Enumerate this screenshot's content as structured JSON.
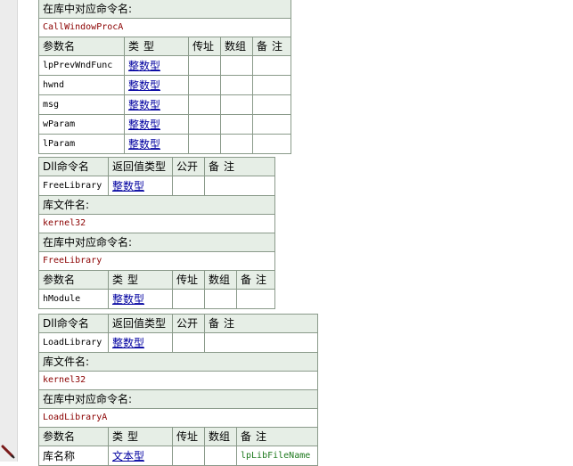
{
  "labels": {
    "dll_cmd": "Dll命令名",
    "return_type": "返回值类型",
    "public": "公开",
    "remark": "备注",
    "lib_file": "库文件名:",
    "lib_cmd": "在库中对应命令名:",
    "param_name": "参数名",
    "type": "类型",
    "by_ref": "传址",
    "array": "数组"
  },
  "block1": {
    "lib_cmd_value": "CallWindowProcA",
    "params": [
      {
        "name": "lpPrevWndFunc",
        "type": "整数型"
      },
      {
        "name": "hwnd",
        "type": "整数型"
      },
      {
        "name": "msg",
        "type": "整数型"
      },
      {
        "name": "wParam",
        "type": "整数型"
      },
      {
        "name": "lParam",
        "type": "整数型"
      }
    ]
  },
  "block2": {
    "name": "FreeLibrary",
    "return_type": "整数型",
    "lib_file": "kernel32",
    "lib_cmd": "FreeLibrary",
    "params": [
      {
        "name": "hModule",
        "type": "整数型"
      }
    ]
  },
  "block3": {
    "name": "LoadLibrary",
    "return_type": "整数型",
    "lib_file": "kernel32",
    "lib_cmd": "LoadLibraryA",
    "params": [
      {
        "name": "库名称",
        "type": "文本型",
        "remark": "lpLibFileName"
      }
    ]
  }
}
